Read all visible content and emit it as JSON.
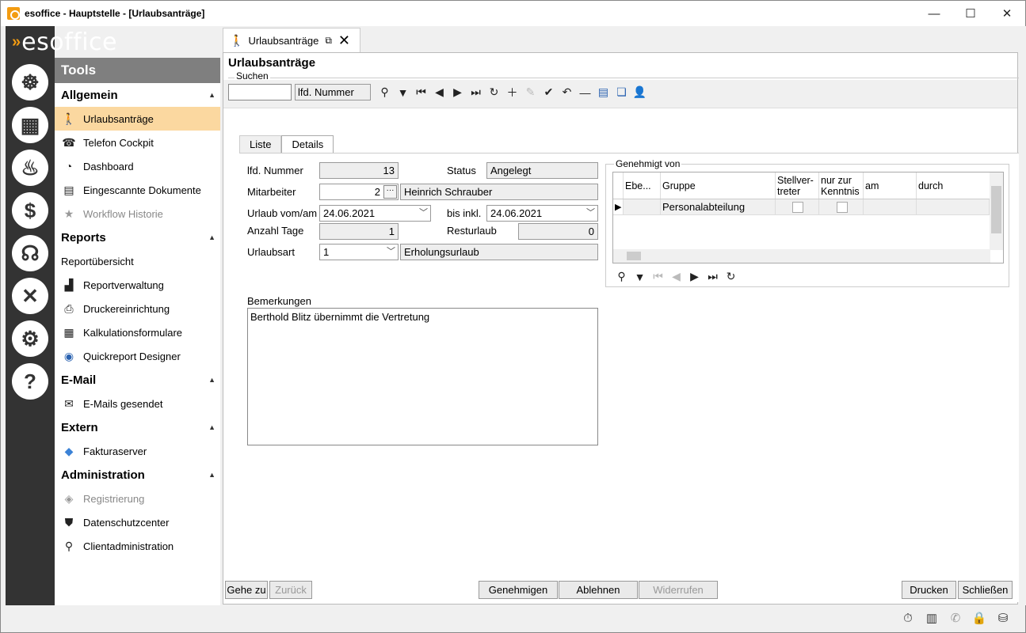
{
  "window": {
    "title": "esoffice - Hauptstelle - [Urlaubsanträge]",
    "controls": {
      "minimize": "—",
      "maximize": "☐",
      "close": "✕"
    }
  },
  "brand": {
    "text_main": "esoffice"
  },
  "sidebar": {
    "tools_label": "Tools",
    "sections": [
      {
        "label": "Allgemein",
        "items": [
          {
            "label": "Urlaubsanträge",
            "icon": "walking-person-icon",
            "state": "active"
          },
          {
            "label": "Telefon Cockpit",
            "icon": "phone-icon"
          },
          {
            "label": "Dashboard",
            "icon": "gauge-icon"
          },
          {
            "label": "Eingescannte Dokumente",
            "icon": "document-icon"
          },
          {
            "label": "Workflow Historie",
            "icon": "star-icon",
            "state": "disabled"
          }
        ]
      },
      {
        "label": "Reports",
        "items": [
          {
            "label": "Reportübersicht",
            "icon": "",
            "state": "plain"
          },
          {
            "label": "Reportverwaltung",
            "icon": "report-bars-icon"
          },
          {
            "label": "Druckereinrichtung",
            "icon": "printer-icon"
          },
          {
            "label": "Kalkulationsformulare",
            "icon": "calculator-icon"
          },
          {
            "label": "Quickreport Designer",
            "icon": "designer-icon"
          }
        ]
      },
      {
        "label": "E-Mail",
        "items": [
          {
            "label": "E-Mails gesendet",
            "icon": "envelope-icon"
          }
        ]
      },
      {
        "label": "Extern",
        "items": [
          {
            "label": "Fakturaserver",
            "icon": "server-icon"
          }
        ]
      },
      {
        "label": "Administration",
        "items": [
          {
            "label": "Registrierung",
            "icon": "register-icon",
            "state": "disabled"
          },
          {
            "label": "Datenschutzcenter",
            "icon": "shield-icon"
          },
          {
            "label": "Clientadministration",
            "icon": "network-icon"
          }
        ]
      }
    ]
  },
  "doc_tab": {
    "label": "Urlaubsanträge"
  },
  "panel": {
    "title": "Urlaubsanträge",
    "search_legend": "Suchen",
    "search_field": "lfd. Nummer"
  },
  "subtabs": [
    "Liste",
    "Details"
  ],
  "form": {
    "lfd_nummer_label": "lfd. Nummer",
    "lfd_nummer_value": "13",
    "status_label": "Status",
    "status_value": "Angelegt",
    "mitarbeiter_label": "Mitarbeiter",
    "mitarbeiter_id": "2",
    "mitarbeiter_name": "Heinrich Schrauber",
    "urlaub_von_label": "Urlaub vom/am",
    "urlaub_von_value": "24.06.2021",
    "bis_label": "bis inkl.",
    "bis_value": "24.06.2021",
    "anzahl_label": "Anzahl Tage",
    "anzahl_value": "1",
    "resturlaub_label": "Resturlaub",
    "resturlaub_value": "0",
    "urlaubsart_label": "Urlaubsart",
    "urlaubsart_id": "1",
    "urlaubsart_name": "Erholungsurlaub",
    "bemerkungen_label": "Bemerkungen",
    "bemerkungen_value": "Berthold Blitz übernimmt die Vertretung"
  },
  "approval": {
    "legend": "Genehmigt von",
    "headers": [
      "Ebe...",
      "Gruppe",
      "Stellver-treter",
      "nur zur Kenntnis",
      "am",
      "durch"
    ],
    "rows": [
      {
        "ebene": "",
        "gruppe": "Personalabteilung",
        "stellvertreter": false,
        "kenntnis": false,
        "am": "",
        "durch": ""
      }
    ]
  },
  "buttons": {
    "gehe_zu": "Gehe zu",
    "zurueck": "Zurück",
    "genehmigen": "Genehmigen",
    "ablehnen": "Ablehnen",
    "widerrufen": "Widerrufen",
    "drucken": "Drucken",
    "schliessen": "Schließen"
  },
  "colors": {
    "accent_orange": "#f39c12",
    "active_item": "#fbd8a0",
    "navbar_dark": "#333333"
  }
}
